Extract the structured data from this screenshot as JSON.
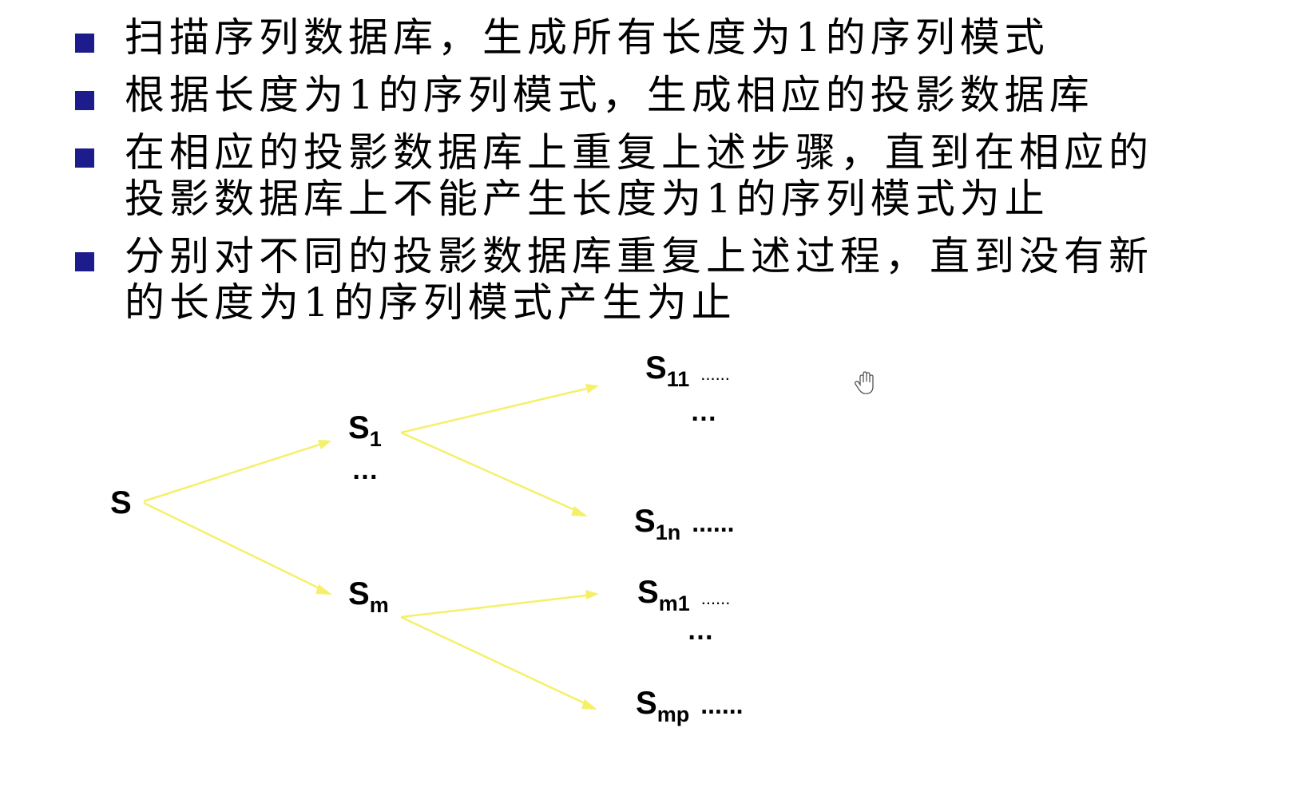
{
  "bullets": [
    {
      "text": "扫描序列数据库，生成所有长度为1的序列模式"
    },
    {
      "text": "根据长度为1的序列模式，生成相应的投影数据库"
    },
    {
      "lines": [
        "在相应的投影数据库上重复上述步骤，直到在相应的",
        "投影数据库上不能产生长度为1的序列模式为止"
      ]
    },
    {
      "lines": [
        "分别对不同的投影数据库重复上述过程，直到没有新",
        "的长度为1的序列模式产生为止"
      ]
    }
  ],
  "diagram": {
    "root": {
      "base": "S"
    },
    "level1": [
      {
        "base": "S",
        "sub": "1"
      },
      {
        "ellipsis": "…"
      },
      {
        "base": "S",
        "sub": "m"
      }
    ],
    "level2": [
      {
        "base": "S",
        "sub": "11",
        "trail": "......"
      },
      {
        "ellipsis": "…"
      },
      {
        "base": "S",
        "sub": "1n",
        "trail": "......"
      },
      {
        "base": "S",
        "sub": "m1",
        "trail": "......"
      },
      {
        "ellipsis": "…"
      },
      {
        "base": "S",
        "sub": "mp",
        "trail": "......"
      }
    ],
    "arrow_color": "#f5f06a",
    "bullet_color": "#1c1c8c"
  },
  "cursor": {
    "icon": "hand-cursor-icon"
  }
}
